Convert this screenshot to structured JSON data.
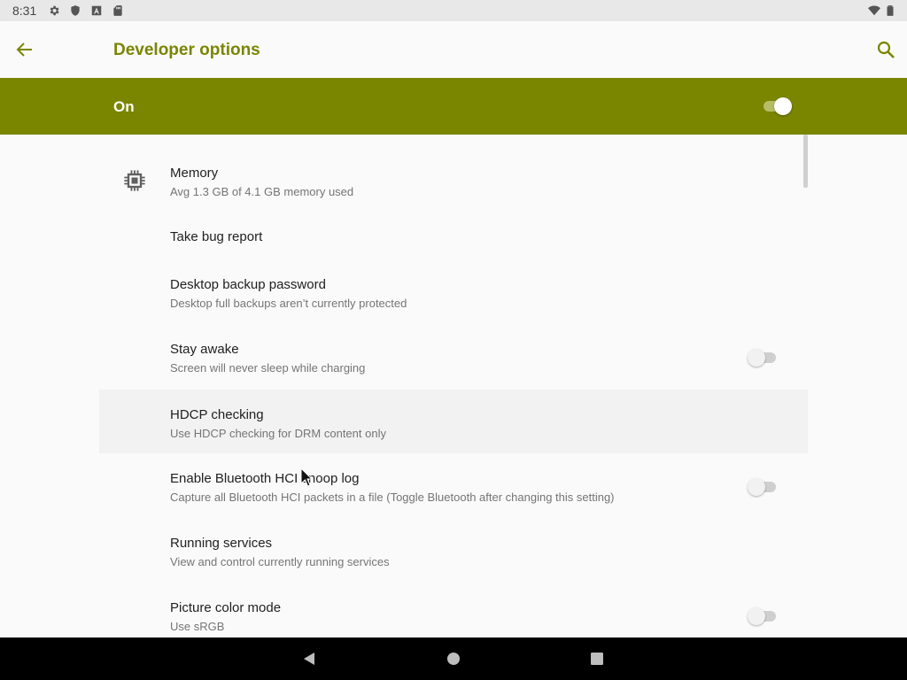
{
  "status_bar": {
    "time": "8:31",
    "left_icons": [
      "settings-icon",
      "shield-icon",
      "a-letter-icon",
      "sd-card-icon"
    ],
    "right_icons": [
      "wifi-icon",
      "battery-icon"
    ]
  },
  "app_bar": {
    "title": "Developer options",
    "back_icon": "arrow-back-icon",
    "search_icon": "search-icon"
  },
  "master_switch": {
    "label": "On",
    "checked": true
  },
  "settings": [
    {
      "title": "Memory",
      "summary": "Avg 1.3 GB of 4.1 GB memory used",
      "icon": "memory-chip-icon"
    },
    {
      "title": "Take bug report"
    },
    {
      "title": "Desktop backup password",
      "summary": "Desktop full backups aren’t currently protected"
    },
    {
      "title": "Stay awake",
      "summary": "Screen will never sleep while charging",
      "toggle": false
    },
    {
      "title": "HDCP checking",
      "summary": "Use HDCP checking for DRM content only"
    },
    {
      "title": "Enable Bluetooth HCI snoop log",
      "summary": "Capture all Bluetooth HCI packets in a file (Toggle Bluetooth after changing this setting)",
      "toggle": false
    },
    {
      "title": "Running services",
      "summary": "View and control currently running services"
    },
    {
      "title": "Picture color mode",
      "summary": "Use sRGB",
      "toggle": false
    }
  ],
  "nav_bar": {
    "back": "triangle-back-icon",
    "home": "circle-home-icon",
    "recents": "square-recents-icon"
  },
  "colors": {
    "accent": "#7a8500",
    "background": "#fafafa",
    "status_bar": "#e8e8e8",
    "nav_bar": "#000000"
  }
}
